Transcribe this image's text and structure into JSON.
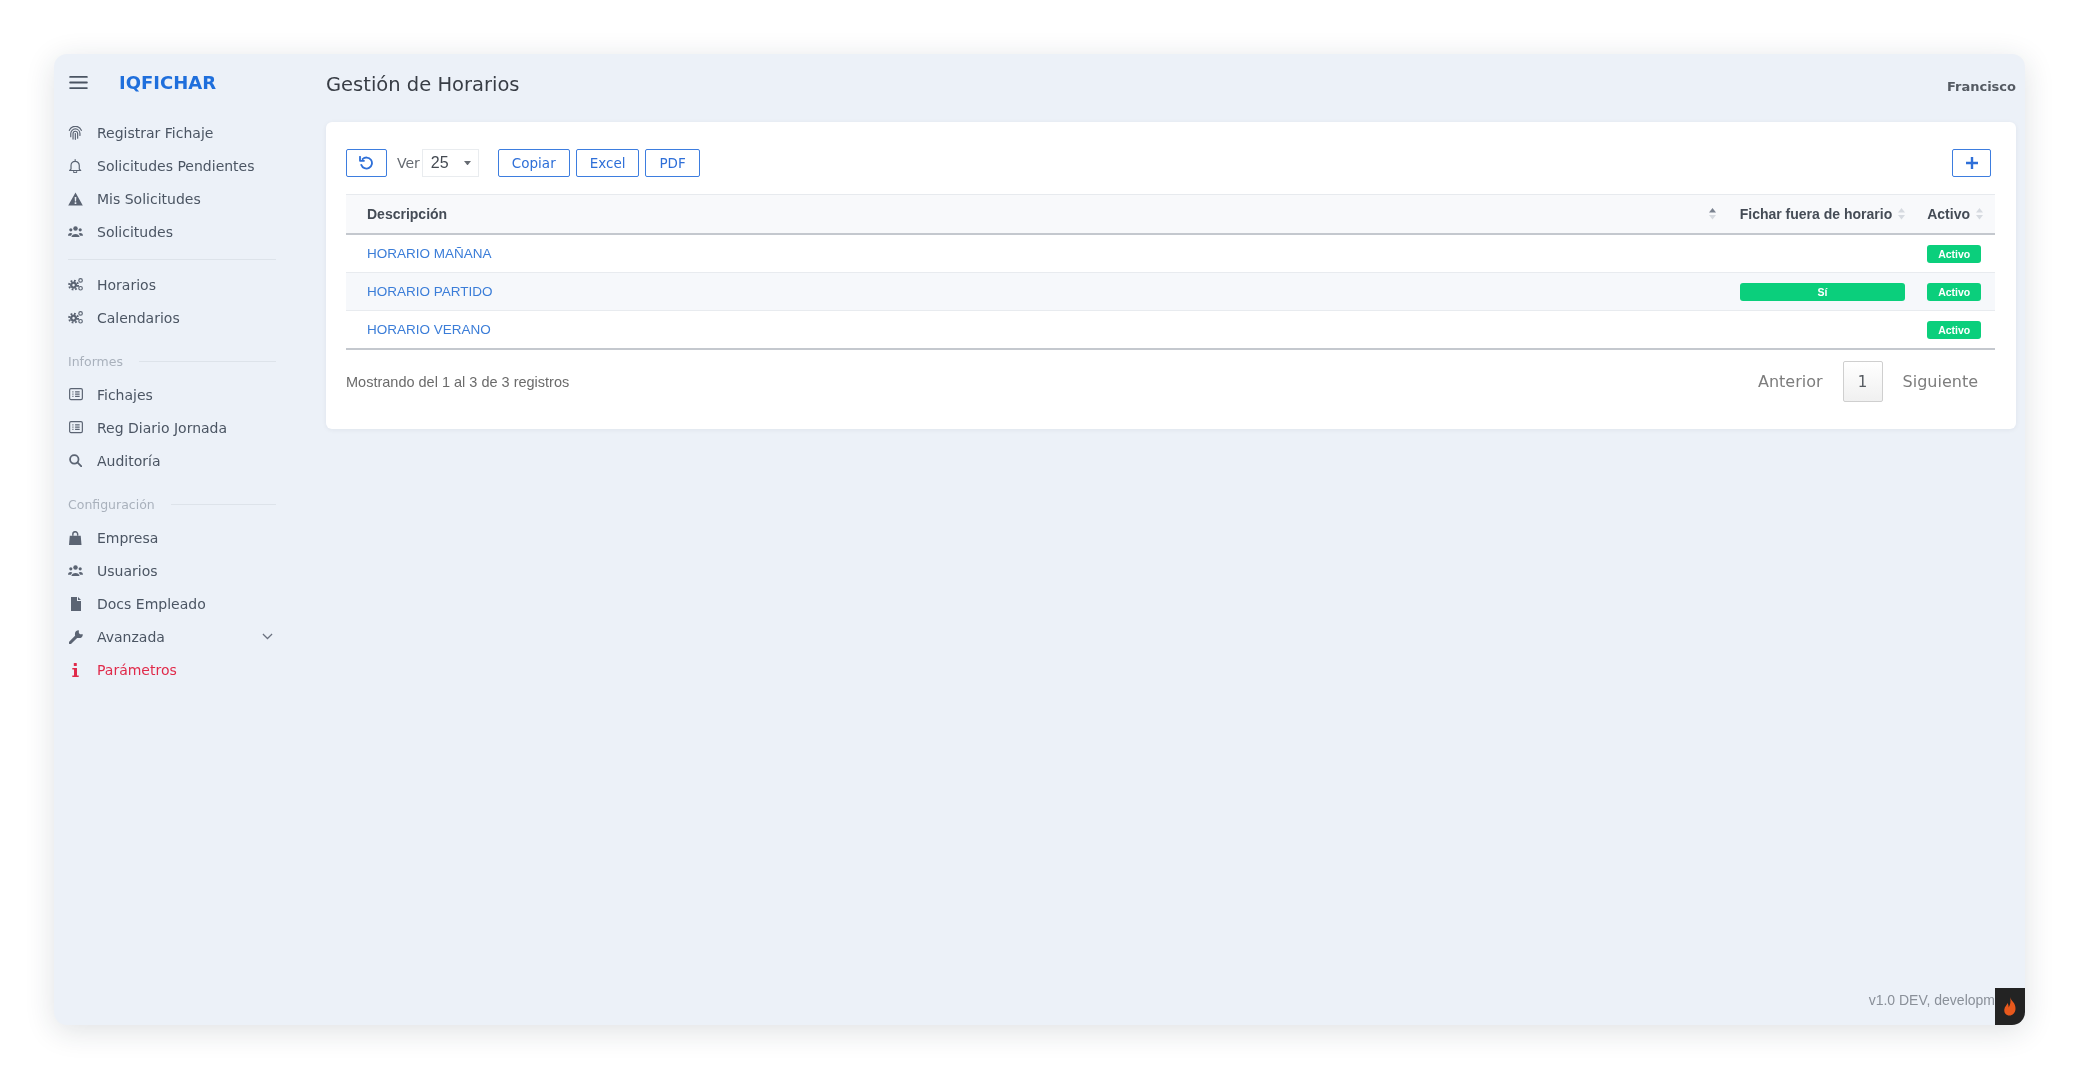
{
  "sidebar": {
    "brand": "IQFICHAR",
    "groups": [
      {
        "items": [
          {
            "label": "Registrar Fichaje",
            "kind": "link"
          },
          {
            "label": "Solicitudes Pendientes",
            "kind": "link"
          },
          {
            "label": "Mis Solicitudes",
            "kind": "link"
          },
          {
            "label": "Solicitudes",
            "kind": "link"
          }
        ]
      },
      {
        "items": [
          {
            "label": "Horarios",
            "kind": "link"
          },
          {
            "label": "Calendarios",
            "kind": "link"
          }
        ]
      },
      {
        "heading": "Informes",
        "items": [
          {
            "label": "Fichajes",
            "kind": "link"
          },
          {
            "label": "Reg Diario Jornada",
            "kind": "link"
          },
          {
            "label": "Auditoría",
            "kind": "link"
          }
        ]
      },
      {
        "heading": "Configuración",
        "items": [
          {
            "label": "Empresa",
            "kind": "link"
          },
          {
            "label": "Usuarios",
            "kind": "link"
          },
          {
            "label": "Docs Empleado",
            "kind": "link"
          },
          {
            "label": "Avanzada",
            "kind": "submenu",
            "expanded": false
          },
          {
            "label": "Parámetros",
            "kind": "alert"
          }
        ]
      }
    ]
  },
  "header": {
    "title": "Gestión de Horarios",
    "user": "Francisco"
  },
  "toolbar": {
    "page_size": {
      "label": "Ver",
      "value": "25"
    },
    "export_buttons": [
      "Copiar",
      "Excel",
      "PDF"
    ]
  },
  "table": {
    "columns": [
      {
        "label": "Descripción",
        "sorted": true
      },
      {
        "label": "Fichar fuera de horario",
        "sorted": false
      },
      {
        "label": "Activo",
        "sorted": false
      }
    ],
    "rows": [
      {
        "description": "HORARIO MAÑANA",
        "active": "Activo"
      },
      {
        "description": "HORARIO PARTIDO",
        "clock_outside_hours": "Sí",
        "active": "Activo"
      },
      {
        "description": "HORARIO VERANO",
        "active": "Activo"
      }
    ]
  },
  "footer": {
    "info": "Mostrando del 1 al 3 de 3 registros",
    "previous": {
      "label": "Anterior",
      "disabled": true
    },
    "pages": [
      {
        "label": "1",
        "selected": true
      }
    ],
    "next": {
      "label": "Siguiente",
      "disabled": true
    }
  },
  "version": "v1.0 DEV, developm"
}
